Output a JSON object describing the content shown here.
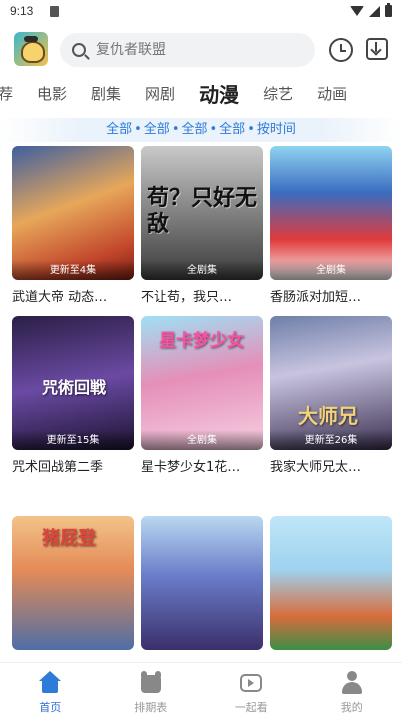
{
  "status_bar": {
    "time": "9:13"
  },
  "search": {
    "placeholder": "复仇者联盟"
  },
  "tabs": [
    {
      "label": "荐"
    },
    {
      "label": "电影"
    },
    {
      "label": "剧集"
    },
    {
      "label": "网剧"
    },
    {
      "label": "动漫",
      "active": true
    },
    {
      "label": "综艺"
    },
    {
      "label": "动画"
    }
  ],
  "filters": [
    "全部",
    "全部",
    "全部",
    "全部",
    "按时间"
  ],
  "cards": [
    {
      "title": "武道大帝 动态…",
      "badge": "更新至4集",
      "poster_text": ""
    },
    {
      "title": "不让苟，我只…",
      "badge": "全剧集",
      "poster_text": "苟？只好无敌"
    },
    {
      "title": "香肠派对加短…",
      "badge": "全剧集",
      "poster_text": ""
    },
    {
      "title": "咒术回战第二季",
      "badge": "更新至15集",
      "poster_text": "咒術回戦"
    },
    {
      "title": "星卡梦少女1花…",
      "badge": "全剧集",
      "poster_text": "星卡梦少女"
    },
    {
      "title": "我家大师兄太…",
      "badge": "更新至26集",
      "poster_text": "大师兄"
    },
    {
      "title": "",
      "badge": "",
      "poster_text": "猪屁登"
    },
    {
      "title": "",
      "badge": "",
      "poster_text": ""
    },
    {
      "title": "",
      "badge": "",
      "poster_text": ""
    }
  ],
  "bottom_nav": [
    {
      "label": "首页",
      "icon": "home-icon",
      "active": true
    },
    {
      "label": "排期表",
      "icon": "schedule-icon"
    },
    {
      "label": "一起看",
      "icon": "watch-icon"
    },
    {
      "label": "我的",
      "icon": "mine-icon"
    }
  ],
  "colors": {
    "accent": "#2f7bd8",
    "nav_active": "#2f6fd1"
  }
}
